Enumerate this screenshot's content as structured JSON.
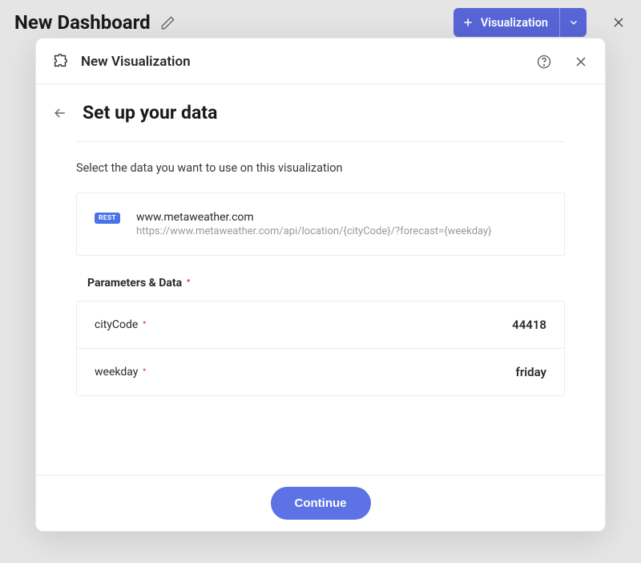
{
  "topbar": {
    "title": "New Dashboard",
    "visualization_label": "Visualization"
  },
  "modal": {
    "header_title": "New Visualization",
    "step_title": "Set up your data",
    "instruction": "Select the data you want to use on this visualization",
    "datasource": {
      "badge": "REST",
      "host": "www.metaweather.com",
      "url": "https://www.metaweather.com/api/location/{cityCode}/?forecast={weekday}"
    },
    "params_section_label": "Parameters & Data",
    "params": [
      {
        "key": "cityCode",
        "value": "44418"
      },
      {
        "key": "weekday",
        "value": "friday"
      }
    ],
    "continue_label": "Continue"
  }
}
